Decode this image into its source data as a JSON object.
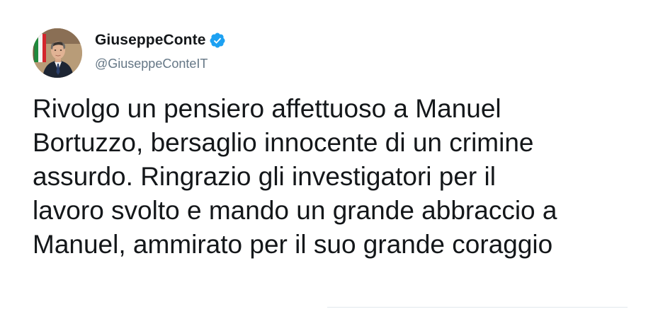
{
  "tweet": {
    "author": {
      "display_name": "GiuseppeConte",
      "handle": "@GiuseppeConteIT",
      "verified": true,
      "avatar_icon": "profile-photo"
    },
    "text_lines": [
      "Rivolgo un pensiero affettuoso a Manuel",
      "Bortuzzo, bersaglio innocente di un crimine",
      "assurdo. Ringrazio gli investigatori per il",
      "lavoro svolto e mando un grande abbraccio a",
      "Manuel, ammirato per il suo grande coraggio"
    ]
  },
  "colors": {
    "text": "#14171a",
    "secondary": "#657786",
    "verified_badge": "#1da1f2",
    "divider": "#e1e8ed"
  }
}
